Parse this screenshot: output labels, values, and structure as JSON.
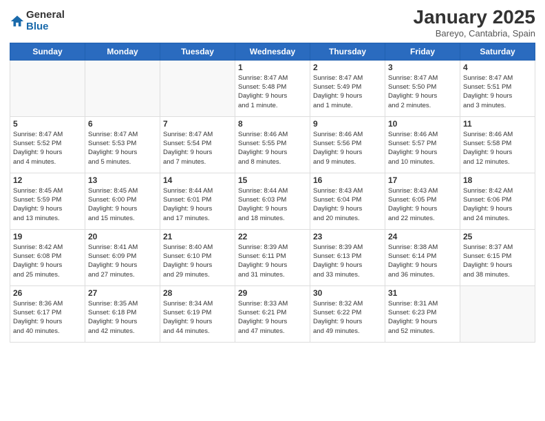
{
  "logo": {
    "general": "General",
    "blue": "Blue"
  },
  "header": {
    "month": "January 2025",
    "location": "Bareyo, Cantabria, Spain"
  },
  "days_of_week": [
    "Sunday",
    "Monday",
    "Tuesday",
    "Wednesday",
    "Thursday",
    "Friday",
    "Saturday"
  ],
  "weeks": [
    [
      {
        "day": "",
        "info": ""
      },
      {
        "day": "",
        "info": ""
      },
      {
        "day": "",
        "info": ""
      },
      {
        "day": "1",
        "info": "Sunrise: 8:47 AM\nSunset: 5:48 PM\nDaylight: 9 hours\nand 1 minute."
      },
      {
        "day": "2",
        "info": "Sunrise: 8:47 AM\nSunset: 5:49 PM\nDaylight: 9 hours\nand 1 minute."
      },
      {
        "day": "3",
        "info": "Sunrise: 8:47 AM\nSunset: 5:50 PM\nDaylight: 9 hours\nand 2 minutes."
      },
      {
        "day": "4",
        "info": "Sunrise: 8:47 AM\nSunset: 5:51 PM\nDaylight: 9 hours\nand 3 minutes."
      }
    ],
    [
      {
        "day": "5",
        "info": "Sunrise: 8:47 AM\nSunset: 5:52 PM\nDaylight: 9 hours\nand 4 minutes."
      },
      {
        "day": "6",
        "info": "Sunrise: 8:47 AM\nSunset: 5:53 PM\nDaylight: 9 hours\nand 5 minutes."
      },
      {
        "day": "7",
        "info": "Sunrise: 8:47 AM\nSunset: 5:54 PM\nDaylight: 9 hours\nand 7 minutes."
      },
      {
        "day": "8",
        "info": "Sunrise: 8:46 AM\nSunset: 5:55 PM\nDaylight: 9 hours\nand 8 minutes."
      },
      {
        "day": "9",
        "info": "Sunrise: 8:46 AM\nSunset: 5:56 PM\nDaylight: 9 hours\nand 9 minutes."
      },
      {
        "day": "10",
        "info": "Sunrise: 8:46 AM\nSunset: 5:57 PM\nDaylight: 9 hours\nand 10 minutes."
      },
      {
        "day": "11",
        "info": "Sunrise: 8:46 AM\nSunset: 5:58 PM\nDaylight: 9 hours\nand 12 minutes."
      }
    ],
    [
      {
        "day": "12",
        "info": "Sunrise: 8:45 AM\nSunset: 5:59 PM\nDaylight: 9 hours\nand 13 minutes."
      },
      {
        "day": "13",
        "info": "Sunrise: 8:45 AM\nSunset: 6:00 PM\nDaylight: 9 hours\nand 15 minutes."
      },
      {
        "day": "14",
        "info": "Sunrise: 8:44 AM\nSunset: 6:01 PM\nDaylight: 9 hours\nand 17 minutes."
      },
      {
        "day": "15",
        "info": "Sunrise: 8:44 AM\nSunset: 6:03 PM\nDaylight: 9 hours\nand 18 minutes."
      },
      {
        "day": "16",
        "info": "Sunrise: 8:43 AM\nSunset: 6:04 PM\nDaylight: 9 hours\nand 20 minutes."
      },
      {
        "day": "17",
        "info": "Sunrise: 8:43 AM\nSunset: 6:05 PM\nDaylight: 9 hours\nand 22 minutes."
      },
      {
        "day": "18",
        "info": "Sunrise: 8:42 AM\nSunset: 6:06 PM\nDaylight: 9 hours\nand 24 minutes."
      }
    ],
    [
      {
        "day": "19",
        "info": "Sunrise: 8:42 AM\nSunset: 6:08 PM\nDaylight: 9 hours\nand 25 minutes."
      },
      {
        "day": "20",
        "info": "Sunrise: 8:41 AM\nSunset: 6:09 PM\nDaylight: 9 hours\nand 27 minutes."
      },
      {
        "day": "21",
        "info": "Sunrise: 8:40 AM\nSunset: 6:10 PM\nDaylight: 9 hours\nand 29 minutes."
      },
      {
        "day": "22",
        "info": "Sunrise: 8:39 AM\nSunset: 6:11 PM\nDaylight: 9 hours\nand 31 minutes."
      },
      {
        "day": "23",
        "info": "Sunrise: 8:39 AM\nSunset: 6:13 PM\nDaylight: 9 hours\nand 33 minutes."
      },
      {
        "day": "24",
        "info": "Sunrise: 8:38 AM\nSunset: 6:14 PM\nDaylight: 9 hours\nand 36 minutes."
      },
      {
        "day": "25",
        "info": "Sunrise: 8:37 AM\nSunset: 6:15 PM\nDaylight: 9 hours\nand 38 minutes."
      }
    ],
    [
      {
        "day": "26",
        "info": "Sunrise: 8:36 AM\nSunset: 6:17 PM\nDaylight: 9 hours\nand 40 minutes."
      },
      {
        "day": "27",
        "info": "Sunrise: 8:35 AM\nSunset: 6:18 PM\nDaylight: 9 hours\nand 42 minutes."
      },
      {
        "day": "28",
        "info": "Sunrise: 8:34 AM\nSunset: 6:19 PM\nDaylight: 9 hours\nand 44 minutes."
      },
      {
        "day": "29",
        "info": "Sunrise: 8:33 AM\nSunset: 6:21 PM\nDaylight: 9 hours\nand 47 minutes."
      },
      {
        "day": "30",
        "info": "Sunrise: 8:32 AM\nSunset: 6:22 PM\nDaylight: 9 hours\nand 49 minutes."
      },
      {
        "day": "31",
        "info": "Sunrise: 8:31 AM\nSunset: 6:23 PM\nDaylight: 9 hours\nand 52 minutes."
      },
      {
        "day": "",
        "info": ""
      }
    ]
  ]
}
